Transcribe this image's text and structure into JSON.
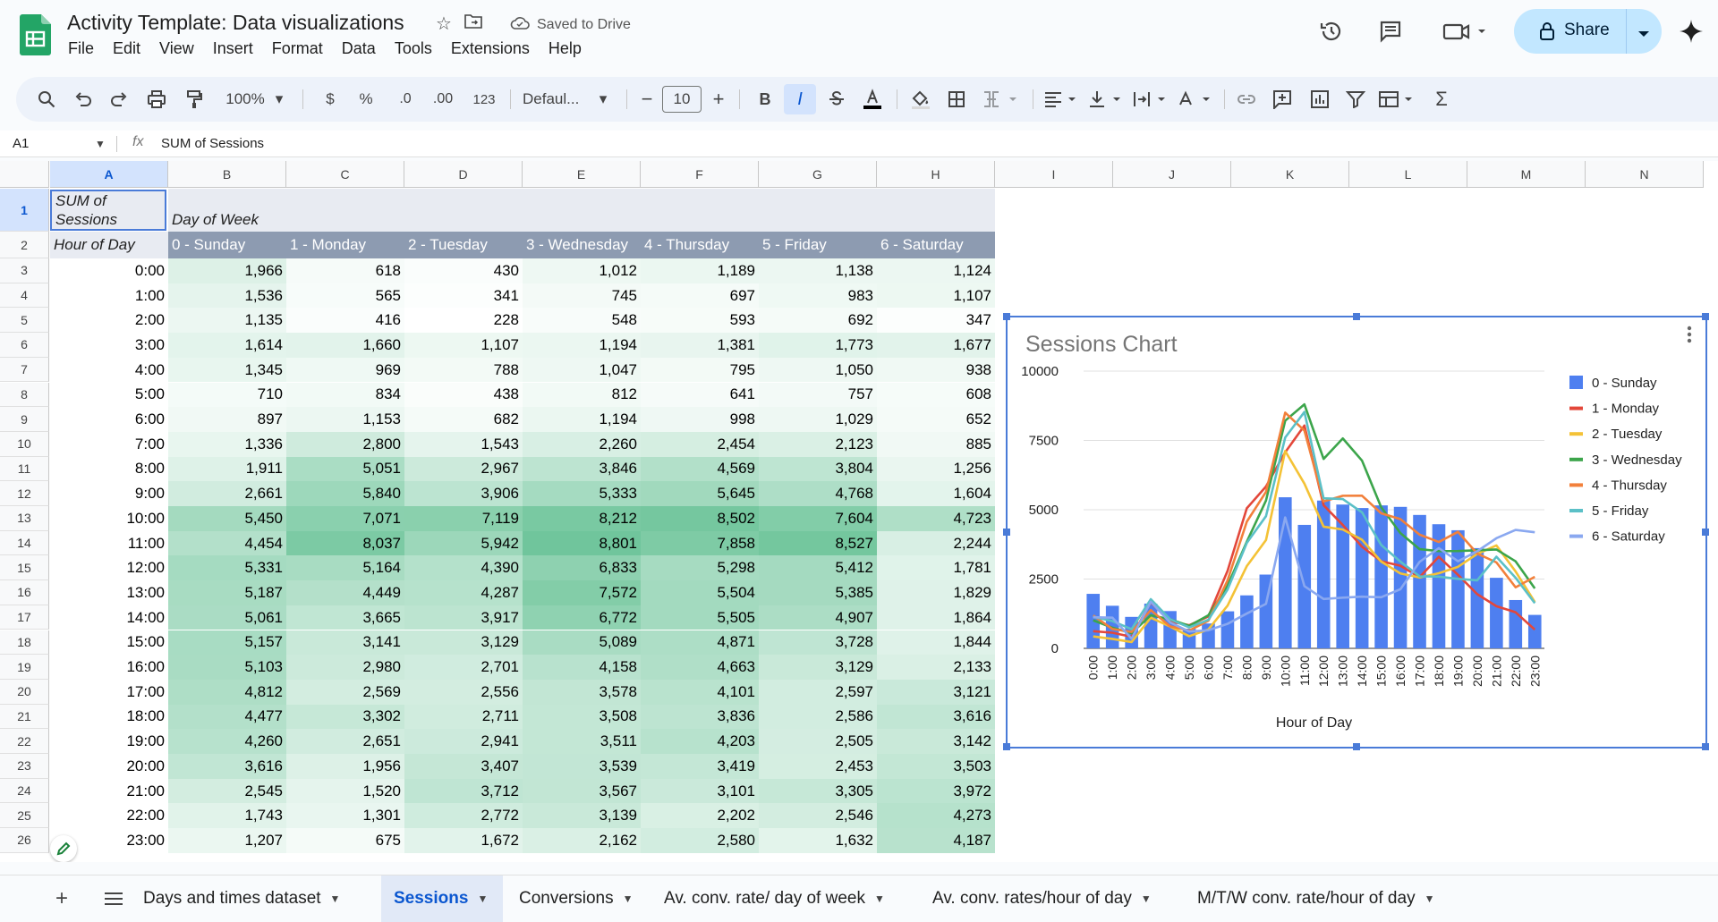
{
  "app": {
    "doc_title": "Activity Template: Data visualizations",
    "saved_status": "Saved to Drive",
    "share_label": "Share",
    "menu": [
      "File",
      "Edit",
      "View",
      "Insert",
      "Format",
      "Data",
      "Tools",
      "Extensions",
      "Help"
    ]
  },
  "toolbar": {
    "zoom": "100%",
    "currency": "$",
    "percent": "%",
    "dec_decrease": ".0",
    "dec_increase": ".00",
    "number_format": "123",
    "font": "Defaul...",
    "font_size": "10",
    "bold": "B",
    "italic": "I"
  },
  "formula_bar": {
    "name_box": "A1",
    "fx": "fx",
    "value": "SUM of Sessions"
  },
  "columns": [
    "A",
    "B",
    "C",
    "D",
    "E",
    "F",
    "G",
    "H",
    "I",
    "J",
    "K",
    "L",
    "M",
    "N"
  ],
  "rows": [
    "1",
    "2",
    "3",
    "4",
    "5",
    "6",
    "7",
    "8",
    "9",
    "10",
    "11",
    "12",
    "13",
    "14",
    "15",
    "16",
    "17",
    "18",
    "19",
    "20",
    "21",
    "22",
    "23",
    "24",
    "25",
    "26"
  ],
  "pivot": {
    "corner_label": "SUM of Sessions",
    "corner_line1": "SUM of",
    "corner_line2": "Sessions",
    "col_group_label": "Day of Week",
    "row_label": "Hour of Day",
    "days": [
      "0 - Sunday",
      "1 - Monday",
      "2 - Tuesday",
      "3 - Wednesday",
      "4 - Thursday",
      "5 - Friday",
      "6 - Saturday"
    ],
    "hours": [
      "0:00",
      "1:00",
      "2:00",
      "3:00",
      "4:00",
      "5:00",
      "6:00",
      "7:00",
      "8:00",
      "9:00",
      "10:00",
      "11:00",
      "12:00",
      "13:00",
      "14:00",
      "15:00",
      "16:00",
      "17:00",
      "18:00",
      "19:00",
      "20:00",
      "21:00",
      "22:00",
      "23:00"
    ],
    "values": [
      [
        "1,966",
        "618",
        "430",
        "1,012",
        "1,189",
        "1,138",
        "1,124"
      ],
      [
        "1,536",
        "565",
        "341",
        "745",
        "697",
        "983",
        "1,107"
      ],
      [
        "1,135",
        "416",
        "228",
        "548",
        "593",
        "692",
        "347"
      ],
      [
        "1,614",
        "1,660",
        "1,107",
        "1,194",
        "1,381",
        "1,773",
        "1,677"
      ],
      [
        "1,345",
        "969",
        "788",
        "1,047",
        "795",
        "1,050",
        "938"
      ],
      [
        "710",
        "834",
        "438",
        "812",
        "641",
        "757",
        "608"
      ],
      [
        "897",
        "1,153",
        "682",
        "1,194",
        "998",
        "1,029",
        "652"
      ],
      [
        "1,336",
        "2,800",
        "1,543",
        "2,260",
        "2,454",
        "2,123",
        "885"
      ],
      [
        "1,911",
        "5,051",
        "2,967",
        "3,846",
        "4,569",
        "3,804",
        "1,256"
      ],
      [
        "2,661",
        "5,840",
        "3,906",
        "5,333",
        "5,645",
        "4,768",
        "1,604"
      ],
      [
        "5,450",
        "7,071",
        "7,119",
        "8,212",
        "8,502",
        "7,604",
        "4,723"
      ],
      [
        "4,454",
        "8,037",
        "5,942",
        "8,801",
        "7,858",
        "8,527",
        "2,244"
      ],
      [
        "5,331",
        "5,164",
        "4,390",
        "6,833",
        "5,298",
        "5,412",
        "1,781"
      ],
      [
        "5,187",
        "4,449",
        "4,287",
        "7,572",
        "5,504",
        "5,385",
        "1,829"
      ],
      [
        "5,061",
        "3,665",
        "3,917",
        "6,772",
        "5,505",
        "4,907",
        "1,864"
      ],
      [
        "5,157",
        "3,141",
        "3,129",
        "5,089",
        "4,871",
        "3,728",
        "1,844"
      ],
      [
        "5,103",
        "2,980",
        "2,701",
        "4,158",
        "4,663",
        "3,129",
        "2,133"
      ],
      [
        "4,812",
        "2,569",
        "2,556",
        "3,578",
        "4,101",
        "2,597",
        "3,121"
      ],
      [
        "4,477",
        "3,302",
        "2,711",
        "3,508",
        "3,836",
        "2,586",
        "3,616"
      ],
      [
        "4,260",
        "2,651",
        "2,941",
        "3,511",
        "4,203",
        "2,505",
        "3,142"
      ],
      [
        "3,616",
        "1,956",
        "3,407",
        "3,539",
        "3,419",
        "2,453",
        "3,503"
      ],
      [
        "2,545",
        "1,520",
        "3,712",
        "3,567",
        "3,101",
        "3,305",
        "3,972"
      ],
      [
        "1,743",
        "1,301",
        "2,772",
        "3,139",
        "2,202",
        "2,546",
        "4,273"
      ],
      [
        "1,207",
        "675",
        "1,672",
        "2,162",
        "2,580",
        "1,632",
        "4,187"
      ]
    ]
  },
  "colors": {
    "accent": "#0b57d0",
    "pivot_header_bg": "#e8ebf2",
    "pivot_day_bg": "#8d9bb1",
    "heat_low": "#ffffff",
    "heat_high": "#57bb8a",
    "series": [
      "#4e7ff0",
      "#e3473a",
      "#f4c236",
      "#3ca54b",
      "#f2803b",
      "#5bc0c7",
      "#8aa8f0"
    ]
  },
  "chart_data": {
    "type": "bar",
    "title": "Sessions Chart",
    "xlabel": "Hour of Day",
    "ylabel": "",
    "ylim": [
      0,
      10000
    ],
    "yticks": [
      0,
      2500,
      5000,
      7500,
      10000
    ],
    "legend_position": "right",
    "grid": true,
    "categories": [
      "0:00",
      "1:00",
      "2:00",
      "3:00",
      "4:00",
      "5:00",
      "6:00",
      "7:00",
      "8:00",
      "9:00",
      "10:00",
      "11:00",
      "12:00",
      "13:00",
      "14:00",
      "15:00",
      "16:00",
      "17:00",
      "18:00",
      "19:00",
      "20:00",
      "21:00",
      "22:00",
      "23:00"
    ],
    "series": [
      {
        "name": "0 - Sunday",
        "type": "bar",
        "values": [
          1966,
          1536,
          1135,
          1614,
          1345,
          710,
          897,
          1336,
          1911,
          2661,
          5450,
          4454,
          5331,
          5187,
          5061,
          5157,
          5103,
          4812,
          4477,
          4260,
          3616,
          2545,
          1743,
          1207
        ]
      },
      {
        "name": "1 - Monday",
        "type": "line",
        "values": [
          618,
          565,
          416,
          1660,
          969,
          834,
          1153,
          2800,
          5051,
          5840,
          7071,
          8037,
          5164,
          4449,
          3665,
          3141,
          2980,
          2569,
          3302,
          2651,
          1956,
          1520,
          1301,
          675
        ]
      },
      {
        "name": "2 - Tuesday",
        "type": "line",
        "values": [
          430,
          341,
          228,
          1107,
          788,
          438,
          682,
          1543,
          2967,
          3906,
          7119,
          5942,
          4390,
          4287,
          3917,
          3129,
          2701,
          2556,
          2711,
          2941,
          3407,
          3712,
          2772,
          1672
        ]
      },
      {
        "name": "3 - Wednesday",
        "type": "line",
        "values": [
          1012,
          745,
          548,
          1194,
          1047,
          812,
          1194,
          2260,
          3846,
          5333,
          8212,
          8801,
          6833,
          7572,
          6772,
          5089,
          4158,
          3578,
          3508,
          3511,
          3539,
          3567,
          3139,
          2162
        ]
      },
      {
        "name": "4 - Thursday",
        "type": "line",
        "values": [
          1189,
          697,
          593,
          1381,
          795,
          641,
          998,
          2454,
          4569,
          5645,
          8502,
          7858,
          5298,
          5504,
          5505,
          4871,
          4663,
          4101,
          3836,
          4203,
          3419,
          3101,
          2202,
          2580
        ]
      },
      {
        "name": "5 - Friday",
        "type": "line",
        "values": [
          1138,
          983,
          692,
          1773,
          1050,
          757,
          1029,
          2123,
          3804,
          4768,
          7604,
          8527,
          5412,
          5385,
          4907,
          3728,
          3129,
          2597,
          2586,
          2505,
          2453,
          3305,
          2546,
          1632
        ]
      },
      {
        "name": "6 - Saturday",
        "type": "line",
        "values": [
          1124,
          1107,
          347,
          1677,
          938,
          608,
          652,
          885,
          1256,
          1604,
          4723,
          2244,
          1781,
          1829,
          1864,
          1844,
          2133,
          3121,
          3616,
          3142,
          3503,
          3972,
          4273,
          4187
        ]
      }
    ]
  },
  "sheet_tabs": [
    {
      "label": "Days and times dataset",
      "active": false
    },
    {
      "label": "Sessions",
      "active": true
    },
    {
      "label": "Conversions",
      "active": false
    },
    {
      "label": "Av. conv. rate/ day of week",
      "active": false
    },
    {
      "label": "Av. conv. rates/hour of day",
      "active": false
    },
    {
      "label": "M/T/W conv. rate/hour of day",
      "active": false
    }
  ]
}
